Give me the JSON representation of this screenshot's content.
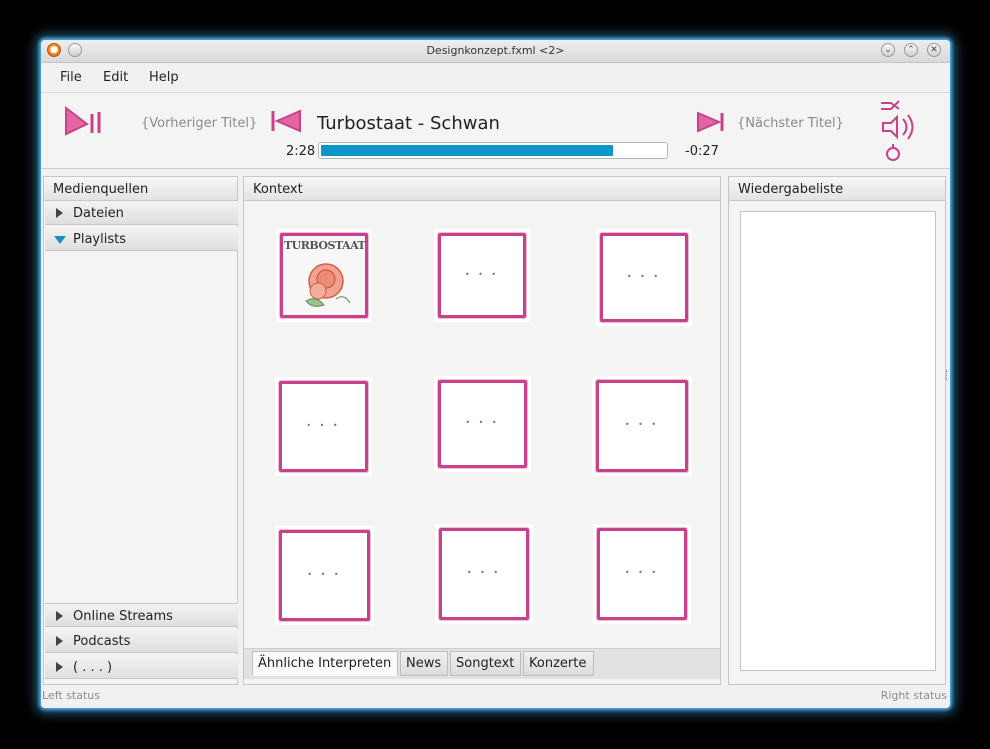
{
  "window": {
    "title": "Designkonzept.fxml <2>"
  },
  "menu": {
    "file": "File",
    "edit": "Edit",
    "help": "Help"
  },
  "player": {
    "previous_hint": "{Vorheriger Titel}",
    "next_hint": "{Nächster Titel}",
    "track": "Turbostaat - Schwan",
    "elapsed": "2:28",
    "remaining": "-0:27",
    "progress_fraction": 0.85,
    "accent_color": "#c8418a",
    "progress_color": "#0a96c7"
  },
  "sources": {
    "header": "Medienquellen",
    "items": [
      {
        "label": "Dateien",
        "expanded": false
      },
      {
        "label": "Playlists",
        "expanded": true
      }
    ],
    "bottom_items": [
      {
        "label": "Online Streams"
      },
      {
        "label": "Podcasts"
      },
      {
        "label": "( . . . )"
      }
    ]
  },
  "context": {
    "header": "Kontext",
    "first_thumb_text": "TURBOSTAAT",
    "tabs": [
      {
        "label": "Ähnliche Interpreten",
        "active": true
      },
      {
        "label": "News",
        "active": false
      },
      {
        "label": "Songtext",
        "active": false
      },
      {
        "label": "Konzerte",
        "active": false
      }
    ]
  },
  "playlist": {
    "header": "Wiedergabeliste"
  },
  "status": {
    "left": "Left status",
    "right": "Right status"
  }
}
